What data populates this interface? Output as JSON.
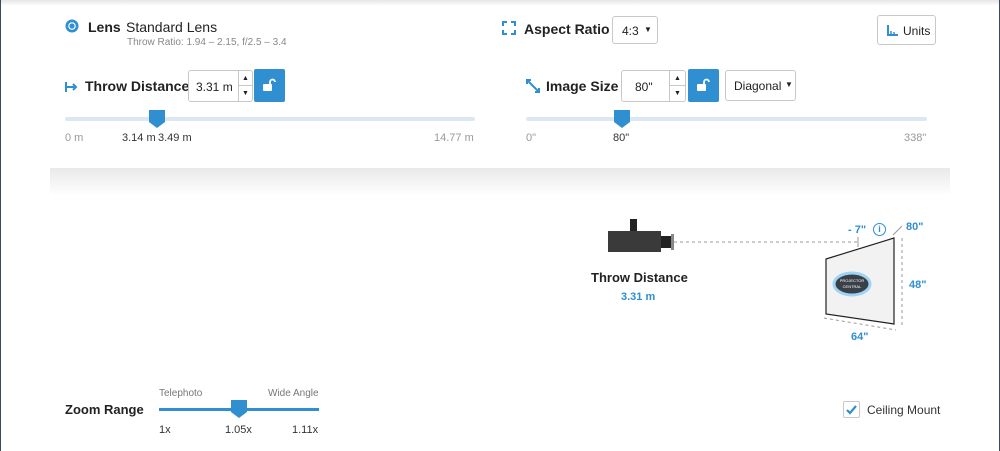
{
  "lens": {
    "label": "Lens",
    "value": "Standard Lens",
    "specs": "Throw Ratio: 1.94 – 2.15, f/2.5 – 3.4"
  },
  "aspect": {
    "label": "Aspect Ratio",
    "value": "4:3"
  },
  "units_button": "Units",
  "throw": {
    "label": "Throw Distance",
    "value": "3.31 m",
    "slider_min": "0 m",
    "slider_max": "14.77 m",
    "marker_low": "3.14 m",
    "marker_value": "3.49 m",
    "position_fraction": 0.224
  },
  "image_size": {
    "label": "Image Size",
    "value": "80\"",
    "mode": "Diagonal",
    "slider_min": "0\"",
    "slider_max": "338\"",
    "marker_value": "80\"",
    "position_fraction": 0.237
  },
  "diagram": {
    "throw_title": "Throw Distance",
    "throw_value": "3.31 m",
    "offset": "- 7\"",
    "diagonal": "80\"",
    "height": "48\"",
    "width": "64\"",
    "logo_line1": "PROJECTOR",
    "logo_line2": "CENTRAL"
  },
  "zoom": {
    "label": "Zoom Range",
    "telephoto": "Telephoto",
    "wide": "Wide Angle",
    "min": "1x",
    "current": "1.05x",
    "max": "1.11x",
    "position_fraction": 0.5
  },
  "ceiling_mount": {
    "label": "Ceiling Mount",
    "checked": true
  },
  "colors": {
    "accent": "#2f8fd0",
    "track": "#dbe8f3"
  }
}
